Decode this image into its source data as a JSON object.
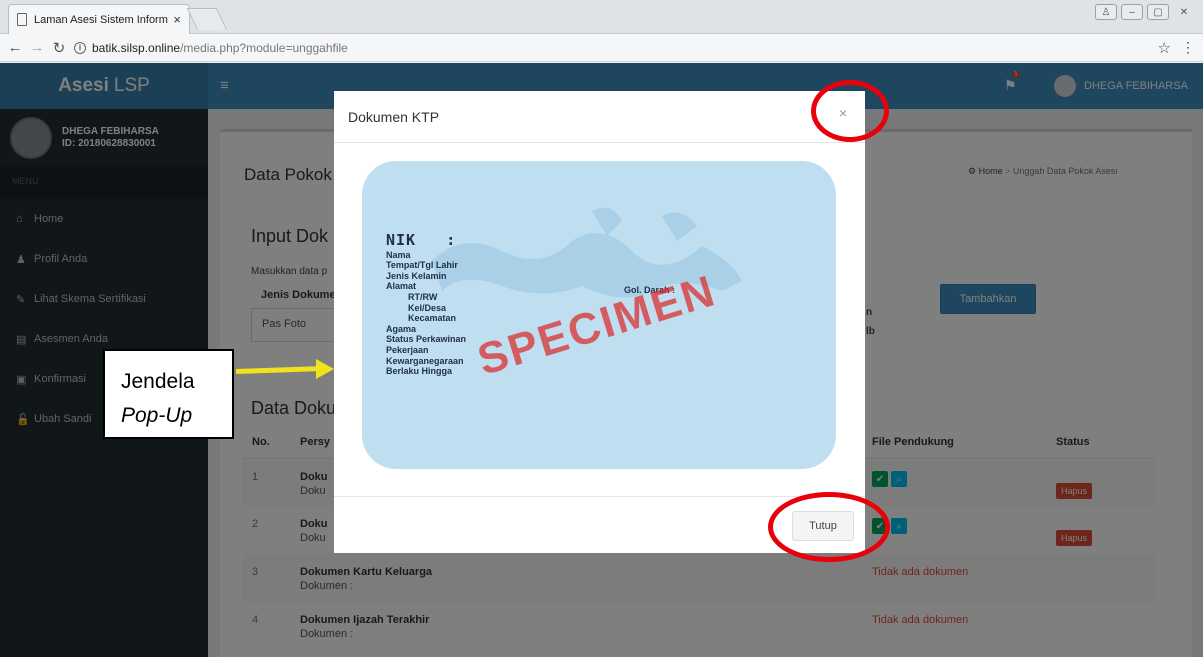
{
  "browser": {
    "tab_title": "Laman Asesi Sistem Inform",
    "tab_close": "×",
    "url_host": "batik.silsp.online",
    "url_path": "/media.php?module=unggahfile"
  },
  "header": {
    "logo_bold": "Asesi",
    "logo_rest": "LSP",
    "notification_count": "1",
    "user_name": "DHEGA FEBIHARSA"
  },
  "sidebar": {
    "user_name": "DHEGA FEBIHARSA",
    "user_id": "ID: 20180628830001",
    "menu_header": "MENU",
    "items": [
      {
        "label": "Home",
        "icon": "home-icon",
        "glyph": "⌂"
      },
      {
        "label": "Profil Anda",
        "icon": "user-icon",
        "glyph": "♟"
      },
      {
        "label": "Lihat Skema Sertifikasi",
        "icon": "edit-icon",
        "glyph": "✎"
      },
      {
        "label": "Asesmen Anda",
        "icon": "file-icon",
        "glyph": "▤"
      },
      {
        "label": "Konfirmasi",
        "icon": "money-icon",
        "glyph": "▣"
      },
      {
        "label": "Ubah Sandi",
        "icon": "lock-icon",
        "glyph": "🔓"
      }
    ]
  },
  "content": {
    "title": "Data Pokok",
    "breadcrumb_home": "Home",
    "breadcrumb_current": "Unggah Data Pokok Asesi",
    "input_title": "Input Dok",
    "help_text": "Masukkan data p",
    "field_label": "Jenis Dokume",
    "select_value": "Pas Foto",
    "frag_right_1": "n",
    "frag_right_2": "lb",
    "add_button": "Tambahkan",
    "table_title": "Data Doku"
  },
  "table": {
    "headers": [
      "No.",
      "Persy",
      "File Pendukung",
      "Status"
    ],
    "rows": [
      {
        "no": "1",
        "name": "Doku",
        "sub": "Doku",
        "hapus": "Hapus"
      },
      {
        "no": "2",
        "name": "Doku",
        "sub": "Doku",
        "hapus": "Hapus"
      },
      {
        "no": "3",
        "name": "Dokumen Kartu Keluarga",
        "sub": "Dokumen :",
        "file": "Tidak ada dokumen"
      },
      {
        "no": "4",
        "name": "Dokumen Ijazah Terakhir",
        "sub": "Dokumen :",
        "file": "Tidak ada dokumen"
      }
    ]
  },
  "modal": {
    "title": "Dokumen KTP",
    "close": "×",
    "footer_button": "Tutup",
    "ktp": {
      "nik": "NIK",
      "nik_colon": ":",
      "fields": [
        "Nama",
        "Tempat/Tgl Lahir",
        "Jenis Kelamin",
        "Alamat"
      ],
      "address_fields": [
        "RT/RW",
        "Kel/Desa",
        "Kecamatan"
      ],
      "more_fields": [
        "Agama",
        "Status Perkawinan",
        "Pekerjaan",
        "Kewarganegaraan",
        "Berlaku Hingga"
      ],
      "gol_darah": "Gol. Darah :",
      "watermark": "SPECIMEN"
    }
  },
  "annotation": {
    "line1": "Jendela",
    "line2": "Pop-Up"
  },
  "colors": {
    "header": "#3c8dbc",
    "sidebar": "#222d32",
    "annotation_ring": "#e8000b",
    "arrow": "#f0e21c"
  }
}
